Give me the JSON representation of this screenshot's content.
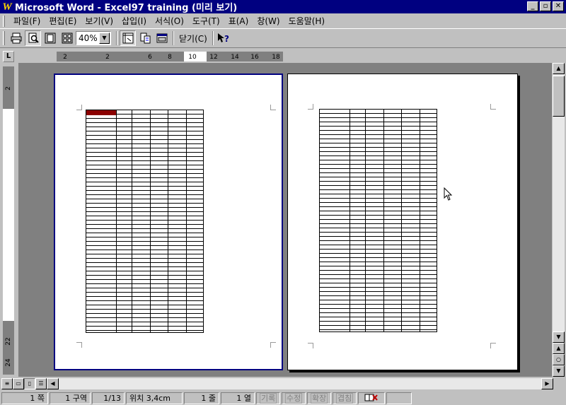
{
  "titlebar": {
    "app_icon": "W",
    "title": "Microsoft Word - Excel97 training (미리 보기)",
    "buttons": {
      "minimize": "_",
      "maximize": "▫",
      "close": "✕"
    }
  },
  "menu": {
    "items": [
      {
        "label": "파일(F)"
      },
      {
        "label": "편집(E)"
      },
      {
        "label": "보기(V)"
      },
      {
        "label": "삽입(I)"
      },
      {
        "label": "서식(O)"
      },
      {
        "label": "도구(T)"
      },
      {
        "label": "표(A)"
      },
      {
        "label": "창(W)"
      },
      {
        "label": "도움말(H)"
      }
    ]
  },
  "toolbar": {
    "icons": [
      "print-icon",
      "magnifier-icon",
      "one-page-icon",
      "multiple-pages-icon",
      "view-ruler-icon",
      "shrink-to-fit-icon",
      "full-screen-icon",
      "context-help-icon"
    ],
    "zoom": "40%",
    "close_label": "닫기(C)"
  },
  "ruler": {
    "corner": "L",
    "h_ticks": [
      "2",
      "2",
      "6",
      "8",
      "10",
      "12",
      "14",
      "16",
      "18"
    ],
    "v_ticks": [
      "2",
      "22",
      "24"
    ]
  },
  "statusbar": {
    "page": "1 쪽",
    "section": "1 구역",
    "page_of": "1/13",
    "position": "위치 3,4cm",
    "line": "1 줄",
    "column": "1 열",
    "modes": [
      "기록",
      "수정",
      "확장",
      "겹침"
    ]
  }
}
